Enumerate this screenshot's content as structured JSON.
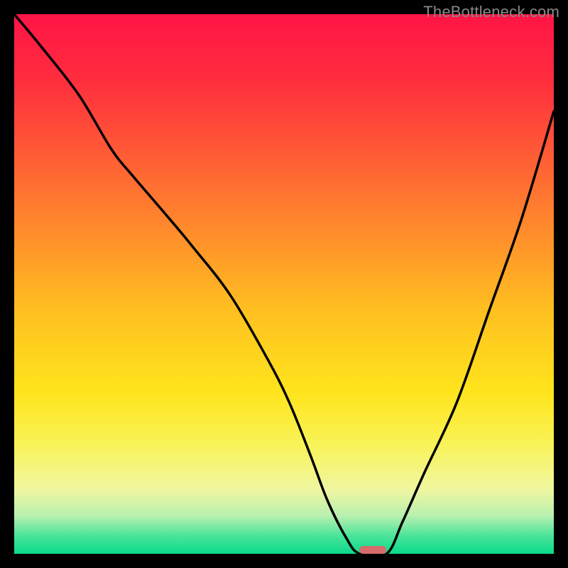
{
  "watermark": "TheBottleneck.com",
  "chart_data": {
    "type": "line",
    "title": "",
    "xlabel": "",
    "ylabel": "",
    "xlim": [
      0,
      100
    ],
    "ylim": [
      0,
      100
    ],
    "series": [
      {
        "name": "bottleneck-curve",
        "x": [
          0,
          5,
          12,
          18,
          22,
          28,
          33,
          40,
          47,
          51,
          55,
          58,
          61.5,
          64,
          69,
          72,
          76,
          82,
          88,
          94,
          100
        ],
        "values": [
          100,
          94,
          85,
          75,
          70,
          63,
          57,
          48,
          36,
          28,
          18,
          10,
          3,
          0,
          0,
          6,
          15,
          28,
          45,
          62,
          82
        ]
      }
    ],
    "marker": {
      "x_pct": 66.5,
      "y_pct": 100,
      "width_pct": 5.0,
      "height_pct": 1.5
    },
    "colors": {
      "gradient_stops": [
        {
          "offset": 0,
          "color": "#ff1446"
        },
        {
          "offset": 0.12,
          "color": "#ff2d3e"
        },
        {
          "offset": 0.25,
          "color": "#ff5836"
        },
        {
          "offset": 0.4,
          "color": "#ff8b2c"
        },
        {
          "offset": 0.55,
          "color": "#ffc020"
        },
        {
          "offset": 0.7,
          "color": "#ffe41c"
        },
        {
          "offset": 0.8,
          "color": "#f8f35a"
        },
        {
          "offset": 0.88,
          "color": "#f0f6a0"
        },
        {
          "offset": 0.93,
          "color": "#b8f0b0"
        },
        {
          "offset": 0.965,
          "color": "#4ee49a"
        },
        {
          "offset": 1.0,
          "color": "#0ada8b"
        }
      ]
    }
  }
}
